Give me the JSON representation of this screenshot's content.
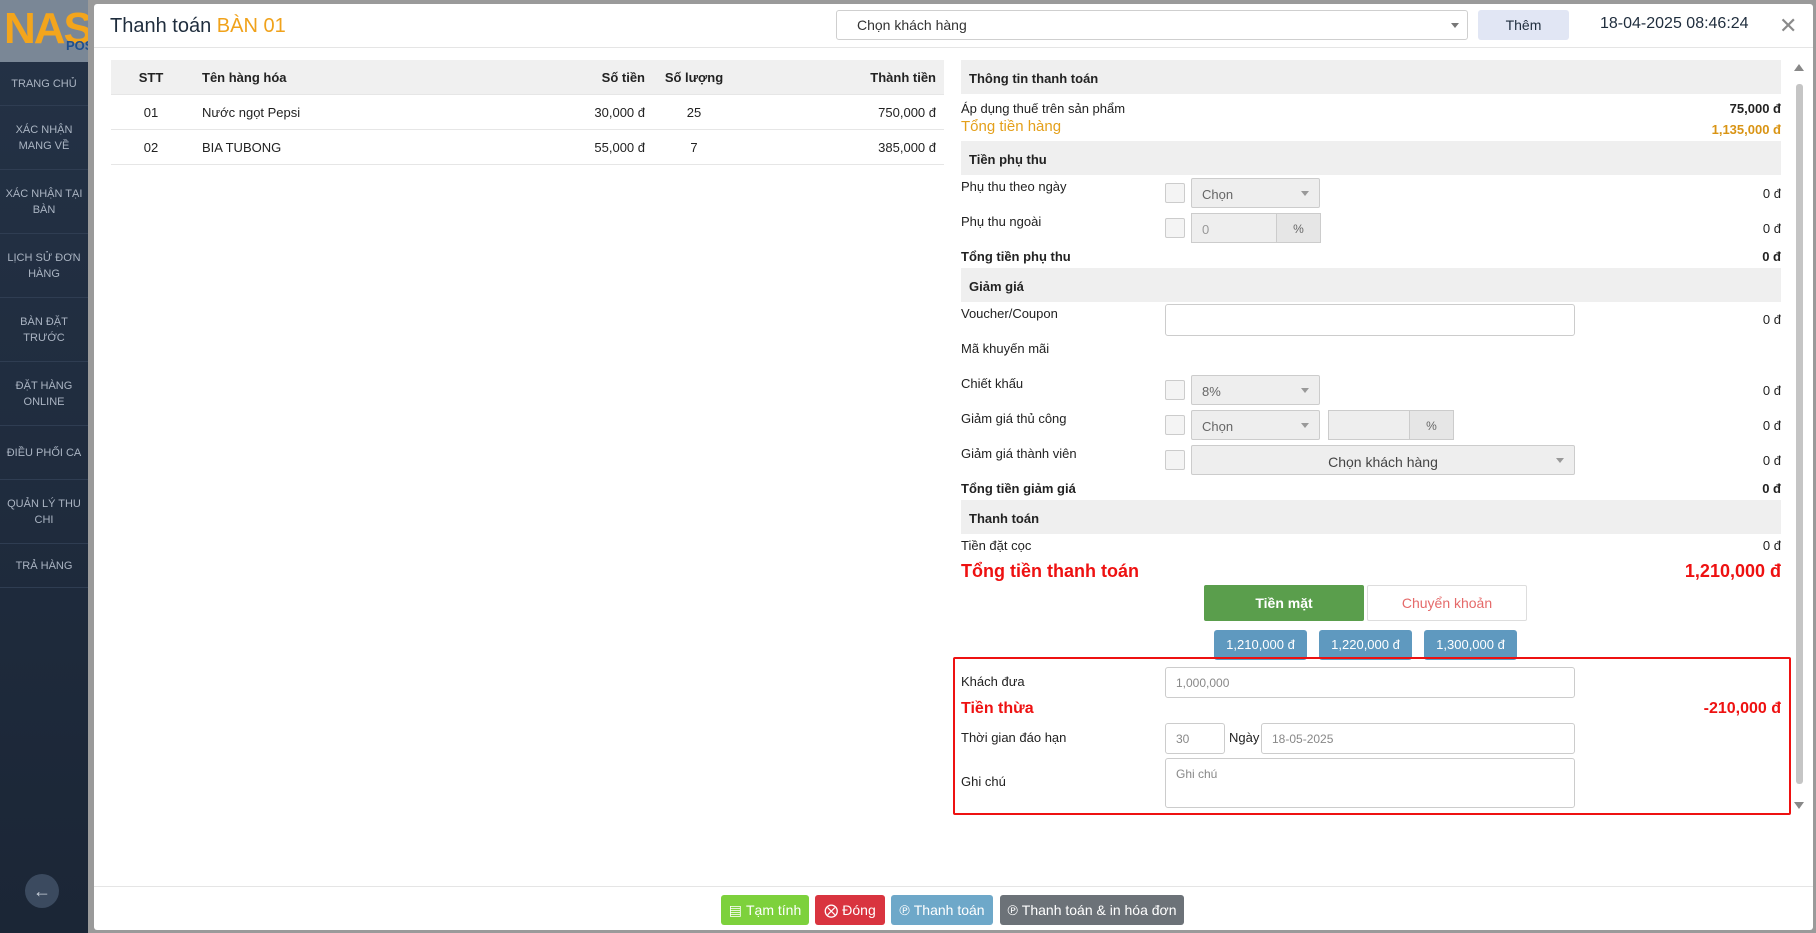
{
  "sidebar": {
    "logo_text": "NAS",
    "logo_sub": "POS",
    "items": [
      {
        "label": "TRANG CHỦ"
      },
      {
        "label": "XÁC NHẬN MANG VỀ"
      },
      {
        "label": "XÁC NHẬN TẠI BÀN"
      },
      {
        "label": "LỊCH SỬ ĐƠN HÀNG"
      },
      {
        "label": "BÀN ĐẶT TRƯỚC"
      },
      {
        "label": "ĐẶT HÀNG ONLINE"
      },
      {
        "label": "ĐIỀU PHỐI CA"
      },
      {
        "label": "QUẢN LÝ THU CHI"
      },
      {
        "label": "TRẢ HÀNG"
      }
    ],
    "back_icon": "arrow-left-icon"
  },
  "header": {
    "title_prefix": "Thanh toán",
    "title_table": "BÀN 01",
    "customer_select": "Chọn khách hàng",
    "add_button": "Thêm",
    "datetime": "18-04-2025 08:46:24",
    "close_icon": "close-icon"
  },
  "order_table": {
    "columns": [
      "STT",
      "Tên hàng hóa",
      "Số tiền",
      "Số lượng",
      "Thành tiền"
    ],
    "rows": [
      {
        "stt": "01",
        "name": "Nước ngọt Pepsi",
        "price": "30,000 đ",
        "qty": "25",
        "total": "750,000 đ"
      },
      {
        "stt": "02",
        "name": "BIA TUBONG",
        "price": "55,000 đ",
        "qty": "7",
        "total": "385,000 đ"
      }
    ]
  },
  "payment": {
    "info_title": "Thông tin thanh toán",
    "tax_label": "Áp dụng thuế trên sản phẩm",
    "tax_value": "75,000 đ",
    "goods_total_label": "Tổng tiền hàng",
    "goods_total_value": "1,135,000 đ",
    "surcharge_title": "Tiền phụ thu",
    "surcharge_day_label": "Phụ thu theo ngày",
    "surcharge_day_select": "Chọn",
    "surcharge_day_value": "0 đ",
    "surcharge_other_label": "Phụ thu ngoài",
    "surcharge_other_input": "0",
    "surcharge_other_unit": "%",
    "surcharge_other_value": "0 đ",
    "surcharge_total_label": "Tổng tiền phụ thu",
    "surcharge_total_value": "0 đ",
    "discount_title": "Giảm giá",
    "voucher_label": "Voucher/Coupon",
    "voucher_value": "0 đ",
    "promo_label": "Mã khuyến mãi",
    "rebate_label": "Chiết khấu",
    "rebate_select": "8%",
    "rebate_value": "0 đ",
    "manual_label": "Giảm giá thủ công",
    "manual_select": "Chọn",
    "manual_unit": "%",
    "manual_value": "0 đ",
    "member_label": "Giảm giá thành viên",
    "member_select": "Chọn khách hàng",
    "member_value": "0 đ",
    "discount_total_label": "Tổng tiền giảm giá",
    "discount_total_value": "0 đ",
    "pay_title": "Thanh toán",
    "deposit_label": "Tiền đặt cọc",
    "deposit_value": "0 đ",
    "grand_label": "Tổng tiền thanh toán",
    "grand_value": "1,210,000 đ",
    "cash_button": "Tiền mặt",
    "bank_button": "Chuyển khoản",
    "quick_amounts": [
      "1,210,000 đ",
      "1,220,000 đ",
      "1,300,000 đ"
    ],
    "given_label": "Khách đưa",
    "given_placeholder": "1,000,000",
    "change_label": "Tiền thừa",
    "change_value": "-210,000 đ",
    "due_label": "Thời gian đáo hạn",
    "due_days": "30",
    "due_unit": "Ngày",
    "due_date": "18-05-2025",
    "note_label": "Ghi chú",
    "note_placeholder": "Ghi chú"
  },
  "footer": {
    "temp_button": "Tạm tính",
    "close_button": "Đóng",
    "pay_button": "Thanh toán",
    "pay_print_button": "Thanh toán & in hóa đơn"
  },
  "colors": {
    "accent_orange": "#f0a21b",
    "cash_green": "#5a9e4c",
    "alert_red": "#e11111",
    "quick_blue": "#5f99bf",
    "temp_green": "#7dd13c",
    "close_red": "#d9343f",
    "pay_blue": "#6ea8c9",
    "print_gray": "#6c7278"
  }
}
